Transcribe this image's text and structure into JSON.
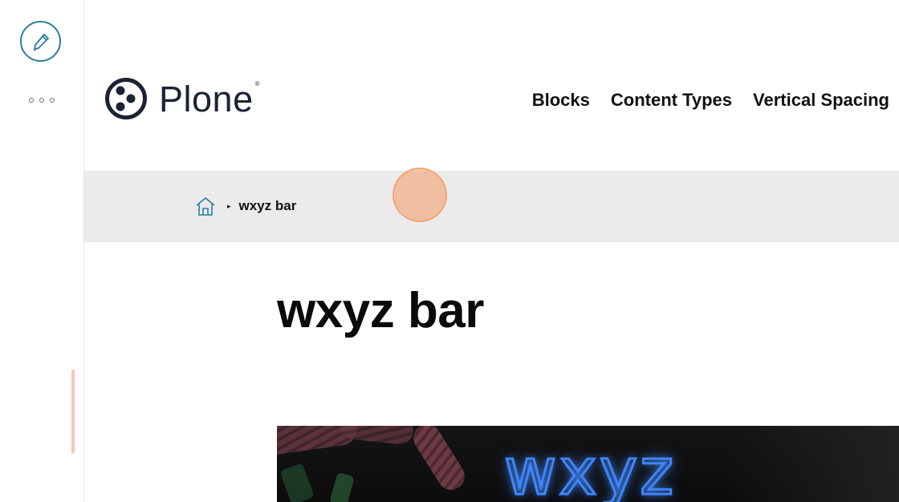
{
  "toolbar": {
    "edit_icon": "pencil-icon",
    "more_icon": "more-dots-icon",
    "accent_color": "#2a7f9e"
  },
  "header": {
    "logo_text": "Plone",
    "logo_mark": "®",
    "nav": [
      "Blocks",
      "Content Types",
      "Vertical Spacing"
    ]
  },
  "breadcrumb": {
    "home_icon": "home-icon",
    "separator": "▸",
    "current": "wxyz bar"
  },
  "page": {
    "title": "wxyz bar",
    "hero_sign_text": "wxyz"
  }
}
